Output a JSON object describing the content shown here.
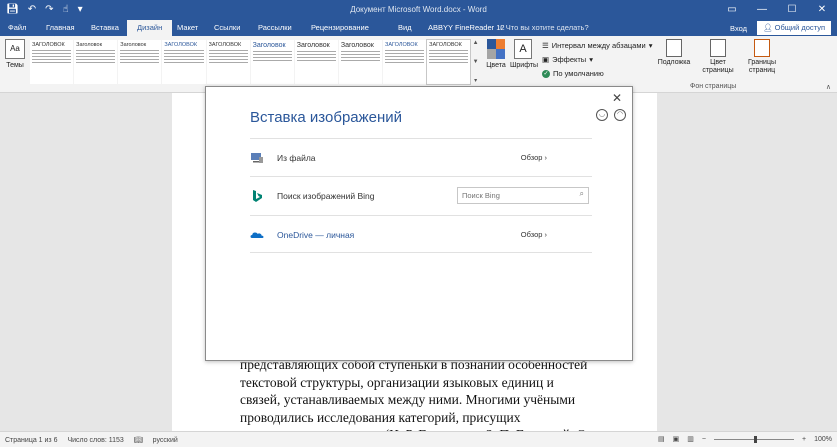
{
  "window": {
    "title": "Документ Microsoft Word.docx - Word",
    "qat": [
      "save-icon",
      "undo-icon",
      "redo-icon",
      "touch-icon",
      "more-icon"
    ],
    "controls": {
      "restore": "▭",
      "minimize": "—",
      "maximize": "☐",
      "close": "✕"
    }
  },
  "tabs": {
    "items": [
      "Файл",
      "Главная",
      "Вставка",
      "Дизайн",
      "Макет",
      "Ссылки",
      "Рассылки",
      "Рецензирование",
      "Вид",
      "ABBYY FineReader 12"
    ],
    "active_index": 3,
    "tell_me": "Что вы хотите сделать?",
    "login": "Вход",
    "share": "Общий доступ"
  },
  "ribbon": {
    "themes_label": "Темы",
    "styles": [
      {
        "heading": "ЗАГОЛОВОК"
      },
      {
        "heading": "Заголовок"
      },
      {
        "heading": "Заголовок"
      },
      {
        "heading": "ЗАГОЛОВОК"
      },
      {
        "heading": "ЗАГОЛОВОК"
      },
      {
        "heading": "Заголовок"
      },
      {
        "heading": "Заголовок"
      },
      {
        "heading": "Заголовок"
      },
      {
        "heading": "ЗАГОЛОВОК"
      },
      {
        "heading": "ЗАГОЛОВОК"
      }
    ],
    "colors_label": "Цвета",
    "fonts_label": "Шрифты",
    "spacing_label": "Интервал между абзацами",
    "effects_label": "Эффекты",
    "default_label": "По умолчанию",
    "watermark_label": "Подложка",
    "page_color_label": "Цвет страницы",
    "page_borders_label": "Границы страниц",
    "group_label": "Фон страницы",
    "theme_colors": [
      "#2b579a",
      "#ed7d31",
      "#a5a5a5",
      "#4472c4"
    ]
  },
  "dialog": {
    "title": "Вставка изображений",
    "rows": [
      {
        "label": "Из файла",
        "action": "Обзор ›"
      },
      {
        "label": "Поиск изображений Bing",
        "search_placeholder": "Поиск Bing"
      },
      {
        "label": "OneDrive — личная",
        "action": "Обзор ›"
      }
    ]
  },
  "document": {
    "lines": [
      "представляющих собой ступеньки в познании особенностей",
      "текстовой структуры, организации языковых единиц и",
      "связей, устанавливаемых между ними. Многими учёными",
      "проводились исследования категорий, присущих",
      "художественному тексту (И. Р. Гальперин, З. П. Горделий, О."
    ]
  },
  "status": {
    "page": "Страница 1 из 6",
    "words": "Число слов: 1153",
    "language": "русский",
    "zoom": "100%",
    "zoom_level": 0.5
  },
  "colors": {
    "accent": "#2b579a",
    "bing": "#008373",
    "onedrive": "#0f6fc6"
  }
}
